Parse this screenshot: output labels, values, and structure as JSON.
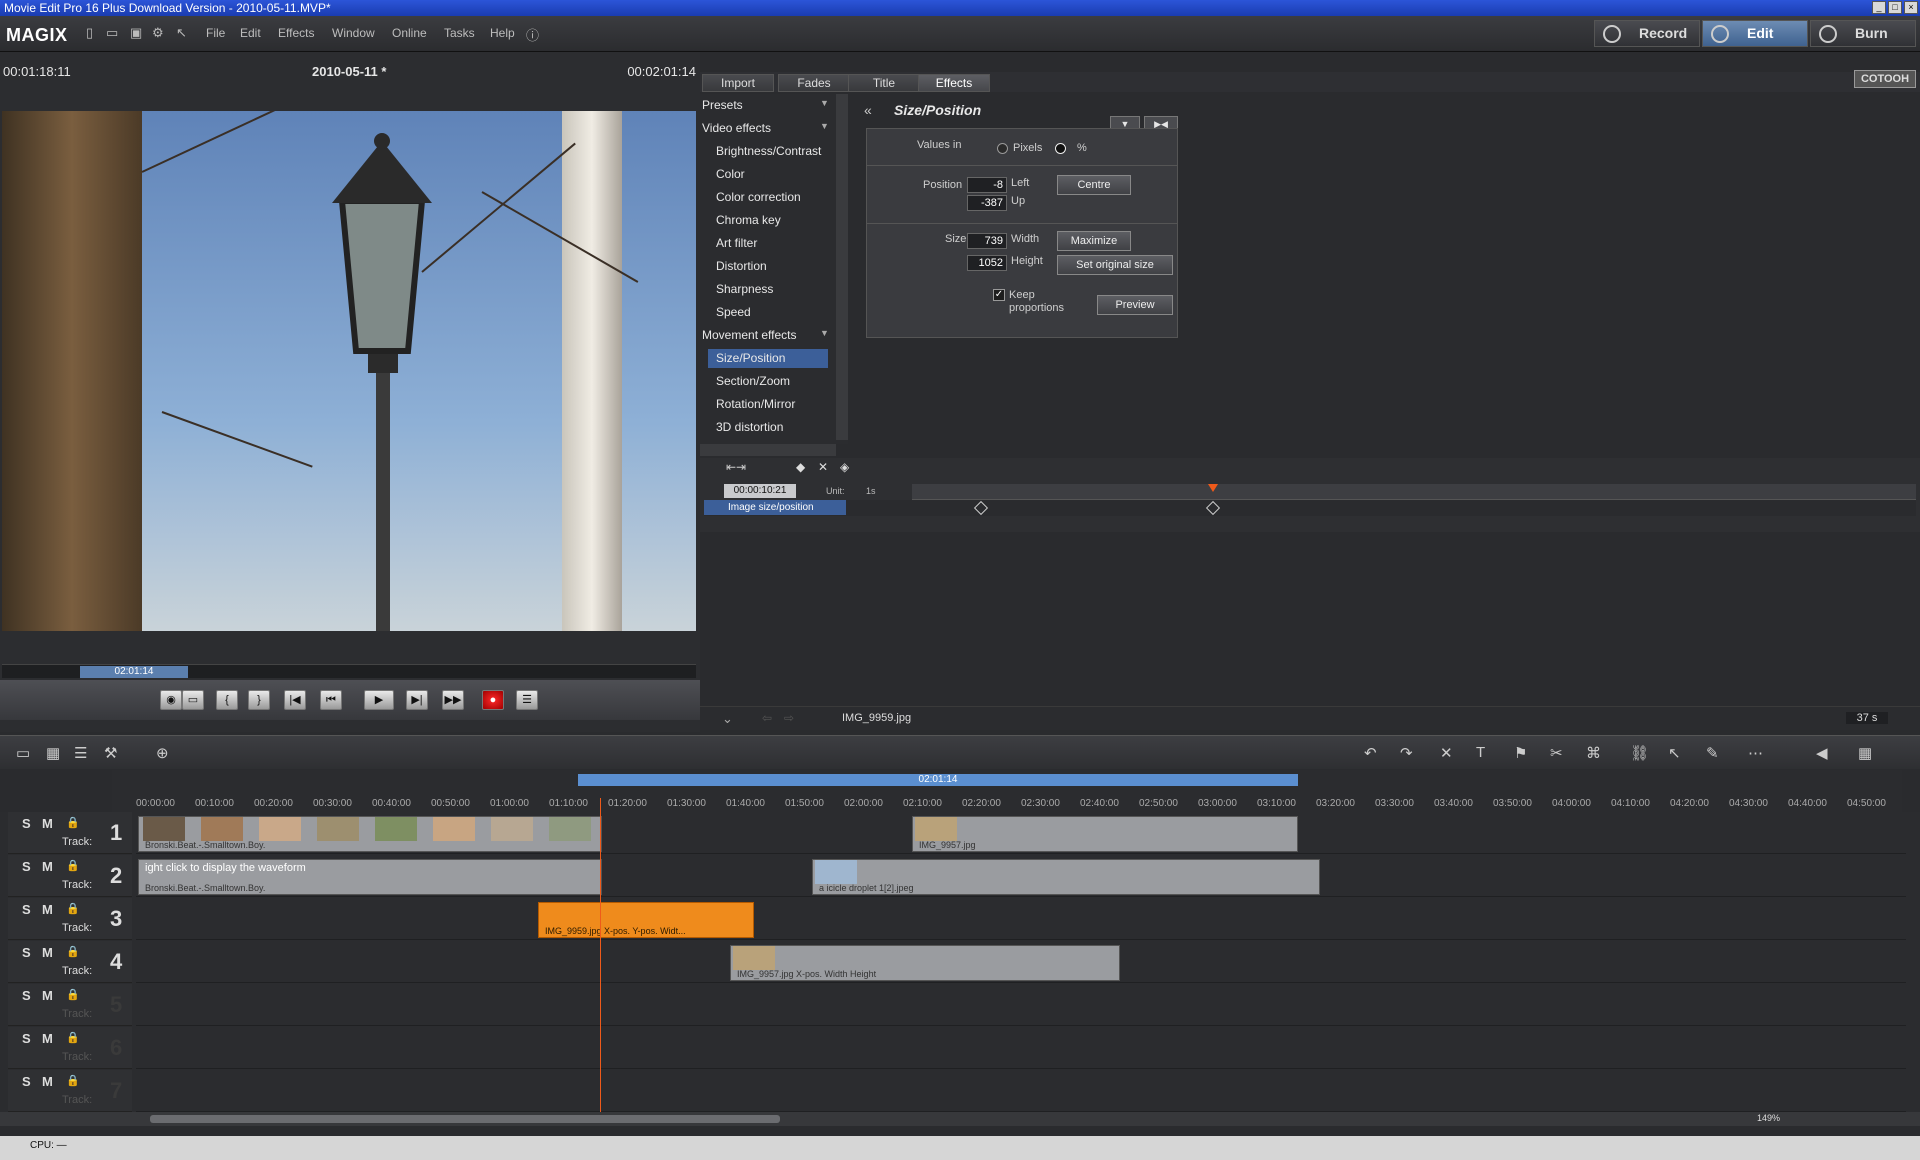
{
  "window": {
    "title": "Movie Edit Pro 16 Plus Download Version - 2010-05-11.MVP*"
  },
  "logo": "MAGIX",
  "menu": [
    "File",
    "Edit",
    "Effects",
    "Window",
    "Online",
    "Tasks",
    "Help"
  ],
  "modes": {
    "record": "Record",
    "edit": "Edit",
    "burn": "Burn",
    "active": "Edit"
  },
  "monitor": {
    "timecode_left": "00:01:18:11",
    "project": "2010-05-11 *",
    "timecode_right": "00:02:01:14",
    "range_label": "02:01:14"
  },
  "tabs": [
    "Import",
    "Fades",
    "Title",
    "Effects"
  ],
  "active_tab": "Effects",
  "cotooh": "COTOOH",
  "effects": {
    "presets": "Presets",
    "video_effects": "Video effects",
    "video_items": [
      "Brightness/Contrast",
      "Color",
      "Color correction",
      "Chroma key",
      "Art filter",
      "Distortion",
      "Sharpness",
      "Speed"
    ],
    "movement_effects": "Movement effects",
    "movement_items": [
      "Size/Position",
      "Section/Zoom",
      "Rotation/Mirror",
      "3D distortion"
    ],
    "selected": "Size/Position"
  },
  "props": {
    "header": "Size/Position",
    "values_in": "Values in",
    "pixels": "Pixels",
    "percent": "%",
    "position_label": "Position",
    "left_value": "-8",
    "left_label": "Left",
    "up_value": "-387",
    "up_label": "Up",
    "centre": "Centre",
    "size_label": "Size",
    "width_value": "739",
    "width_label": "Width",
    "height_value": "1052",
    "height_label": "Height",
    "maximize": "Maximize",
    "set_original": "Set original size",
    "keep": "Keep",
    "proportions": "proportions",
    "preview": "Preview"
  },
  "keyframe": {
    "time": "00:00:10:21",
    "unit_label": "Unit:",
    "unit_value": "1s",
    "param": "Image size/position"
  },
  "preview_status": {
    "file": "IMG_9959.jpg",
    "duration": "37 s"
  },
  "timeline": {
    "range_label": "02:01:14",
    "ticks": [
      "00:00:00",
      "00:10:00",
      "00:20:00",
      "00:30:00",
      "00:40:00",
      "00:50:00",
      "01:00:00",
      "01:10:00",
      "01:20:00",
      "01:30:00",
      "01:40:00",
      "01:50:00",
      "02:00:00",
      "02:10:00",
      "02:20:00",
      "02:30:00",
      "02:40:00",
      "02:50:00",
      "03:00:00",
      "03:10:00",
      "03:20:00",
      "03:30:00",
      "03:40:00",
      "03:50:00",
      "04:00:00",
      "04:10:00",
      "04:20:00",
      "04:30:00",
      "04:40:00",
      "04:50:00"
    ],
    "tracks": [
      "1",
      "2",
      "3",
      "4",
      "5",
      "6",
      "7"
    ],
    "track_label": "Track:",
    "clips": {
      "t1a": "Bronski.Beat.-.Smalltown.Boy.",
      "t1b": "IMG_9957.jpg",
      "t2a_overlay": "ight click to display the waveform",
      "t2a": "Bronski.Beat.-.Smalltown.Boy.",
      "t2b": "a icicle droplet 1[2].jpeg",
      "t3": "IMG_9959.jpg   X-pos.  Y-pos.  Widt...",
      "t4": "IMG_9957.jpg   X-pos.  Width  Height"
    },
    "zoom": "149%"
  },
  "status": {
    "cpu": "CPU: —"
  }
}
